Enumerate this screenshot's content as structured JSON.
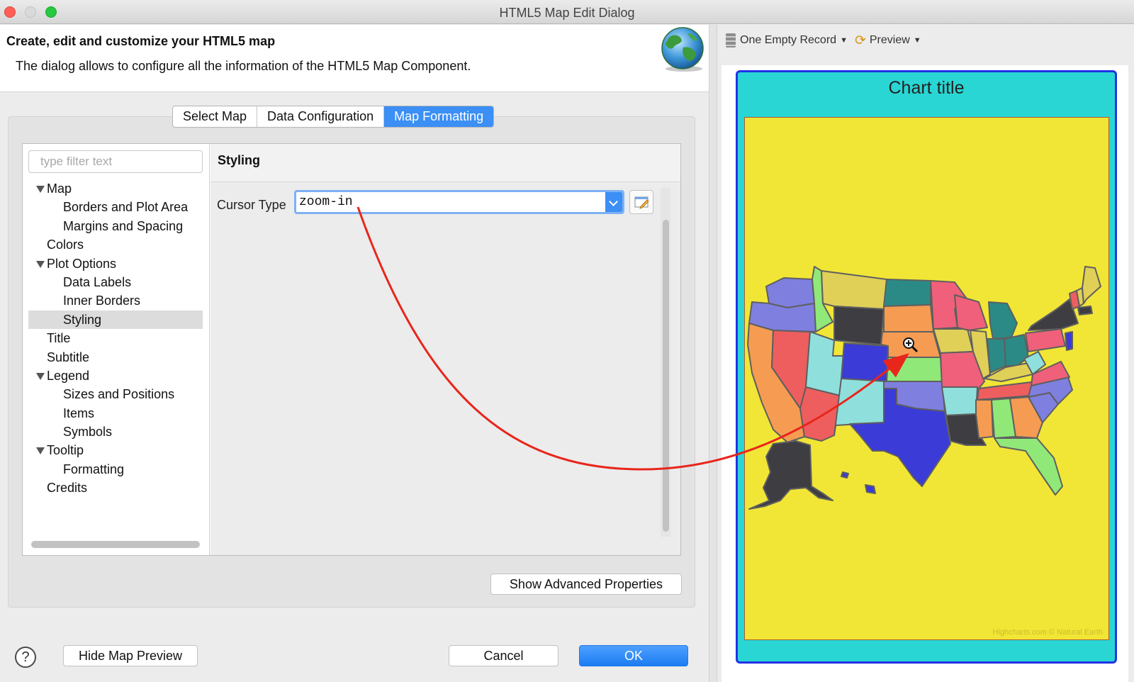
{
  "window": {
    "title": "HTML5 Map Edit Dialog"
  },
  "header": {
    "title": "Create, edit and customize your HTML5 map",
    "description": "The dialog allows to configure all the information of the HTML5 Map Component."
  },
  "tabs": [
    {
      "label": "Select Map",
      "active": false
    },
    {
      "label": "Data Configuration",
      "active": false
    },
    {
      "label": "Map Formatting",
      "active": true
    }
  ],
  "filter": {
    "placeholder": "type filter text"
  },
  "tree": {
    "items": [
      {
        "label": "Map",
        "level": 1,
        "expanded": true
      },
      {
        "label": "Borders and Plot Area",
        "level": 2
      },
      {
        "label": "Margins and Spacing",
        "level": 2
      },
      {
        "label": "Colors",
        "level": 1
      },
      {
        "label": "Plot Options",
        "level": 1,
        "expanded": true
      },
      {
        "label": "Data Labels",
        "level": 2
      },
      {
        "label": "Inner Borders",
        "level": 2
      },
      {
        "label": "Styling",
        "level": 2,
        "selected": true
      },
      {
        "label": "Title",
        "level": 1
      },
      {
        "label": "Subtitle",
        "level": 1
      },
      {
        "label": "Legend",
        "level": 1,
        "expanded": true
      },
      {
        "label": "Sizes and Positions",
        "level": 2
      },
      {
        "label": "Items",
        "level": 2
      },
      {
        "label": "Symbols",
        "level": 2
      },
      {
        "label": "Tooltip",
        "level": 1,
        "expanded": true
      },
      {
        "label": "Formatting",
        "level": 2
      },
      {
        "label": "Credits",
        "level": 1
      }
    ]
  },
  "properties": {
    "section_title": "Styling",
    "cursor_label": "Cursor Type",
    "cursor_value": "zoom-in"
  },
  "buttons": {
    "show_advanced": "Show Advanced Properties",
    "hide_preview": "Hide Map Preview",
    "cancel": "Cancel",
    "ok": "OK",
    "help": "?"
  },
  "preview": {
    "record": "One Empty Record",
    "preview_label": "Preview",
    "chart_title": "Chart title",
    "credits": "Highcharts.com © Natural Earth",
    "colors": {
      "chart_background": "#2ad6d4",
      "chart_border": "#2233e6",
      "plot_background": "#f1e636",
      "accent": "#3b8ff5",
      "annotation_arrow": "#e8261c"
    }
  }
}
